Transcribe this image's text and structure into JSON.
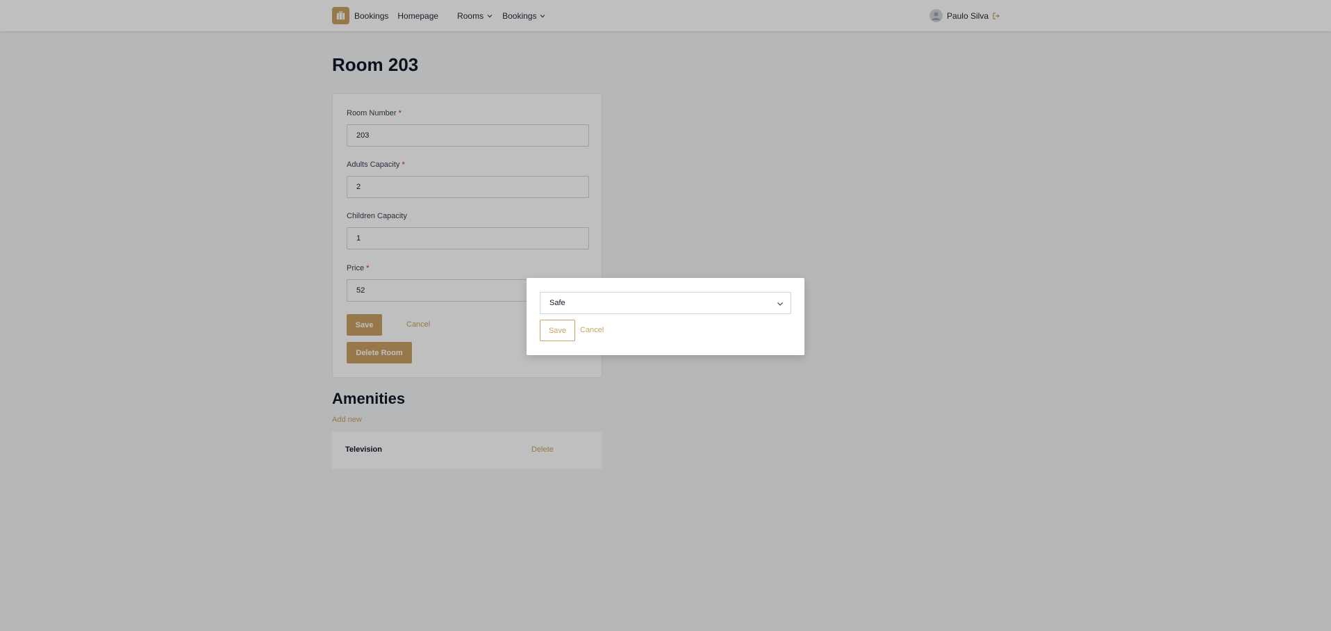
{
  "nav": {
    "brand": "Bookings",
    "homepage": "Homepage",
    "rooms": "Rooms",
    "bookings": "Bookings",
    "user_name": "Paulo Silva"
  },
  "page": {
    "title": "Room 203"
  },
  "form": {
    "room_number_label": "Room Number",
    "room_number_value": "203",
    "adults_label": "Adults Capacity",
    "adults_value": "2",
    "children_label": "Children Capacity",
    "children_value": "1",
    "price_label": "Price",
    "price_value": "52",
    "required_mark": "*",
    "save": "Save",
    "cancel": "Cancel",
    "delete_room": "Delete Room"
  },
  "amenities": {
    "title": "Amenities",
    "add_new": "Add new",
    "items": [
      {
        "name": "Television",
        "delete": "Delete"
      }
    ]
  },
  "modal": {
    "selected": "Safe",
    "save": "Save",
    "cancel": "Cancel"
  },
  "colors": {
    "accent": "#c8a164",
    "required": "#dc2626"
  }
}
